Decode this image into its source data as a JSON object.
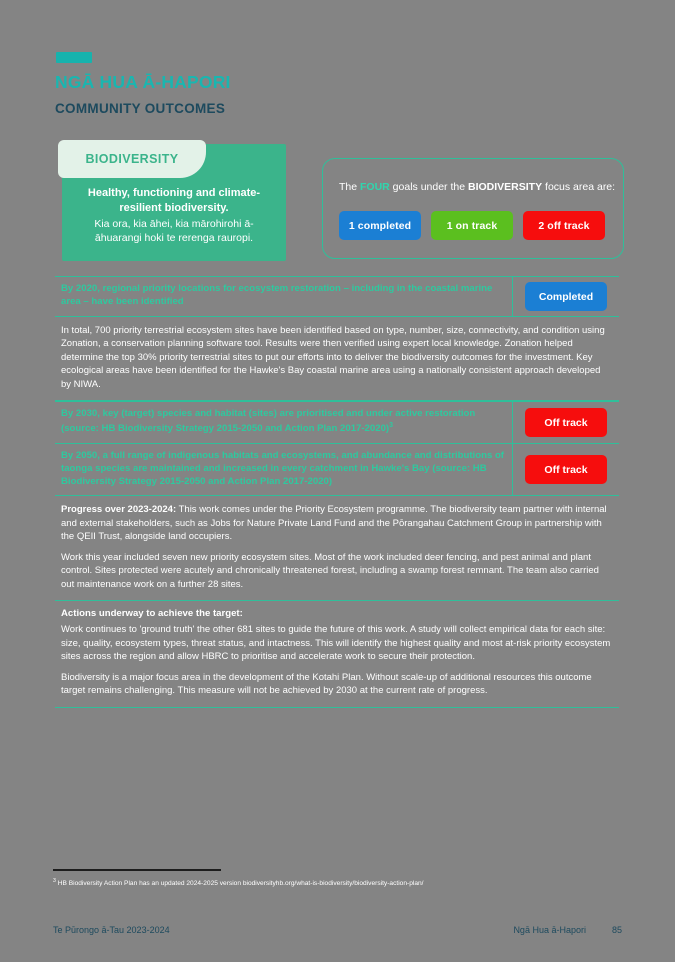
{
  "header": {
    "title_mi": "NGĀ HUA Ā-HAPORI",
    "title_en": "COMMUNITY OUTCOMES",
    "accent_teal": "#19b6b0",
    "subtitle_color": "#1d4a5e"
  },
  "focus_card": {
    "tab_label": "BIODIVERSITY",
    "statement_en": "Healthy, functioning and climate-resilient biodiversity.",
    "statement_mi": "Kia ora, kia āhei, kia mārohirohi ā-āhuarangi hoki te rerenga rauropi.",
    "green": "#3bb48b",
    "tab_bg": "#e3f2e8"
  },
  "kpi": {
    "intro_prefix": "The ",
    "intro_count": "FOUR",
    "intro_middle": " goals under the ",
    "intro_focus": "BIODIVERSITY",
    "intro_suffix": " focus area are:",
    "pills": [
      {
        "label": "1 completed",
        "color": "#1b7fd4",
        "style": "completed"
      },
      {
        "label": "1 on track",
        "color": "#5bbf1f",
        "style": "ontrack"
      },
      {
        "label": "2 off track",
        "color": "#f60d0d",
        "style": "offtrack"
      }
    ]
  },
  "goals": [
    {
      "text": "By 2020, regional priority locations for ecosystem restoration – including in the coastal marine area – have been identified",
      "status": "Completed",
      "status_style": "completed"
    },
    {
      "text": "By 2030, key (target) species and habitat (sites) are prioritised and under active restoration (source: HB Biodiversity Strategy 2015-2050 and Action Plan 2017-2020)",
      "footnote_marker": "3",
      "status": "Off track",
      "status_style": "offtrack"
    },
    {
      "text": "By 2050, a full range of indigenous habitats and ecosystems, and abundance and distributions of taonga species are maintained and increased in every catchment in Hawke's Bay (source: HB Biodiversity Strategy 2015-2050 and Action Plan 2017-2020)",
      "status": "Off track",
      "status_style": "offtrack"
    }
  ],
  "goal1_body": "In total, 700 priority terrestrial ecosystem sites have been identified based on type, number, size, connectivity, and condition using Zonation, a conservation planning software tool. Results were then verified using expert local knowledge. Zonation helped determine the top 30% priority terrestrial sites to put our efforts into to deliver the biodiversity outcomes for the investment. Key ecological areas have been identified for the Hawke's Bay coastal marine area using a nationally consistent approach developed by NIWA.",
  "progress": {
    "heading": "Progress over 2023-2024:",
    "paragraph_1_rest": " This work comes under the Priority Ecosystem programme. The biodiversity team partner with internal and external stakeholders, such as Jobs for Nature Private Land Fund and the Pōrangahau Catchment Group in partnership with the QEII Trust, alongside land occupiers.",
    "paragraph_2": "Work this year included seven new priority ecosystem sites. Most of the work included deer fencing, and pest animal and plant control. Sites protected were acutely and chronically threatened forest, including a swamp forest remnant. The team also carried out maintenance work on a further 28 sites."
  },
  "actions": {
    "heading": "Actions underway to achieve the target:",
    "paragraph_1": "Work continues to 'ground truth' the other 681 sites to guide the future of this work. A study will collect empirical data for each site: size, quality, ecosystem types, threat status, and intactness. This will identify the highest quality and most at-risk priority ecosystem sites across the region and allow HBRC to prioritise and accelerate work to secure their protection.",
    "paragraph_2": "Biodiversity is a major focus area in the development of the Kotahi Plan. Without scale-up of additional resources this outcome target remains challenging. This measure will not be achieved by 2030 at the current rate of progress."
  },
  "footnote": {
    "marker": "3",
    "text": " HB Biodiversity Action Plan has an updated 2024-2025 version biodiversityhb.org/what-is-biodiversity/biodiversity-action-plan/"
  },
  "footer": {
    "left": "Te Pūrongo ā-Tau 2023-2024",
    "right_label": "Ngā Hua ā-Hapori",
    "page_number": "85"
  }
}
